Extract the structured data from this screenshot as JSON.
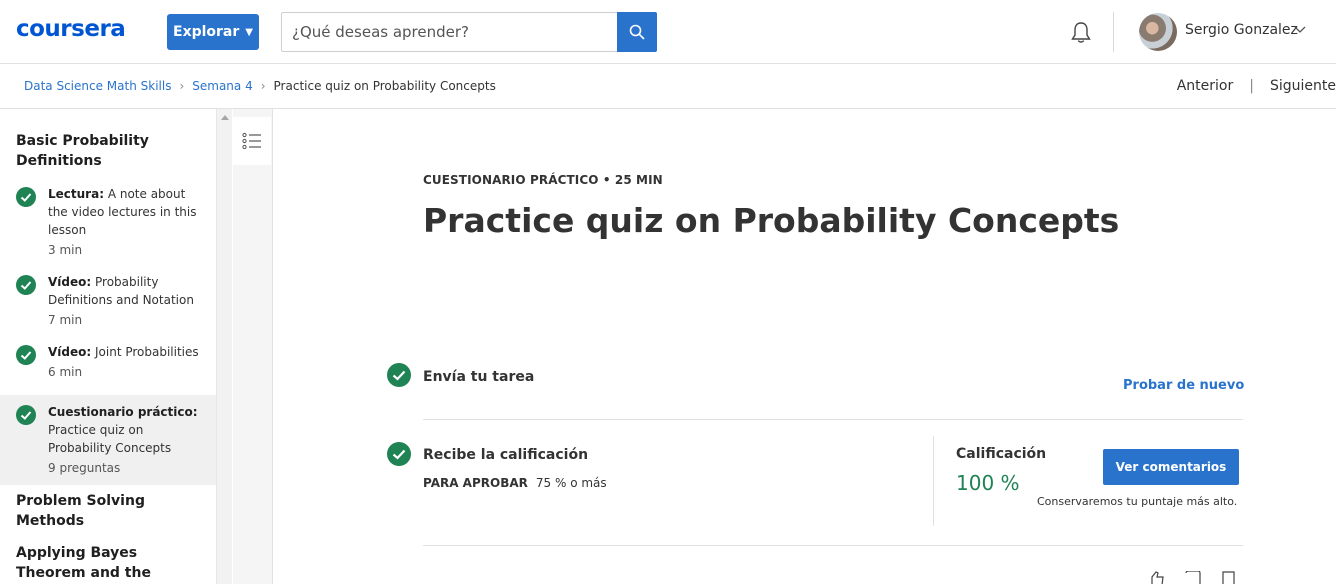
{
  "header": {
    "logo": "coursera",
    "explore_label": "Explorar",
    "search_placeholder": "¿Qué deseas aprender?",
    "user_name": "Sergio Gonzalez"
  },
  "breadcrumb": {
    "items": [
      "Data Science Math Skills",
      "Semana 4"
    ],
    "current": "Practice quiz on Probability Concepts",
    "prev": "Anterior",
    "next": "Siguiente"
  },
  "sidebar": {
    "section1": "Basic Probability Definitions",
    "items": [
      {
        "type": "Lectura:",
        "name": "A note about the video lectures in this lesson",
        "duration": "3 min",
        "done": true
      },
      {
        "type": "Vídeo:",
        "name": "Probability Definitions and Notation",
        "duration": "7 min",
        "done": true
      },
      {
        "type": "Vídeo:",
        "name": "Joint Probabilities",
        "duration": "6 min",
        "done": true
      },
      {
        "type": "Cuestionario práctico:",
        "name": "Practice quiz on Probability Concepts",
        "duration": "9 preguntas",
        "done": true,
        "active": true
      }
    ],
    "section2": "Problem Solving Methods",
    "section3": "Applying Bayes Theorem and the Binomial"
  },
  "main": {
    "eyebrow": "CUESTIONARIO PRÁCTICO • 25 MIN",
    "title": "Practice quiz on Probability Concepts",
    "step1_label": "Envía tu tarea",
    "retry_label": "Probar de nuevo",
    "step2_label": "Recibe la calificación",
    "pass_label": "PARA APROBAR",
    "pass_value": "75 % o más",
    "grade_label": "Calificación",
    "grade_value": "100 %",
    "feedback_label": "Ver comentarios",
    "keep_note": "Conservaremos tu puntaje más alto."
  },
  "colors": {
    "accent": "#2a73cc",
    "logo": "#0056d2",
    "success": "#1f8354"
  }
}
